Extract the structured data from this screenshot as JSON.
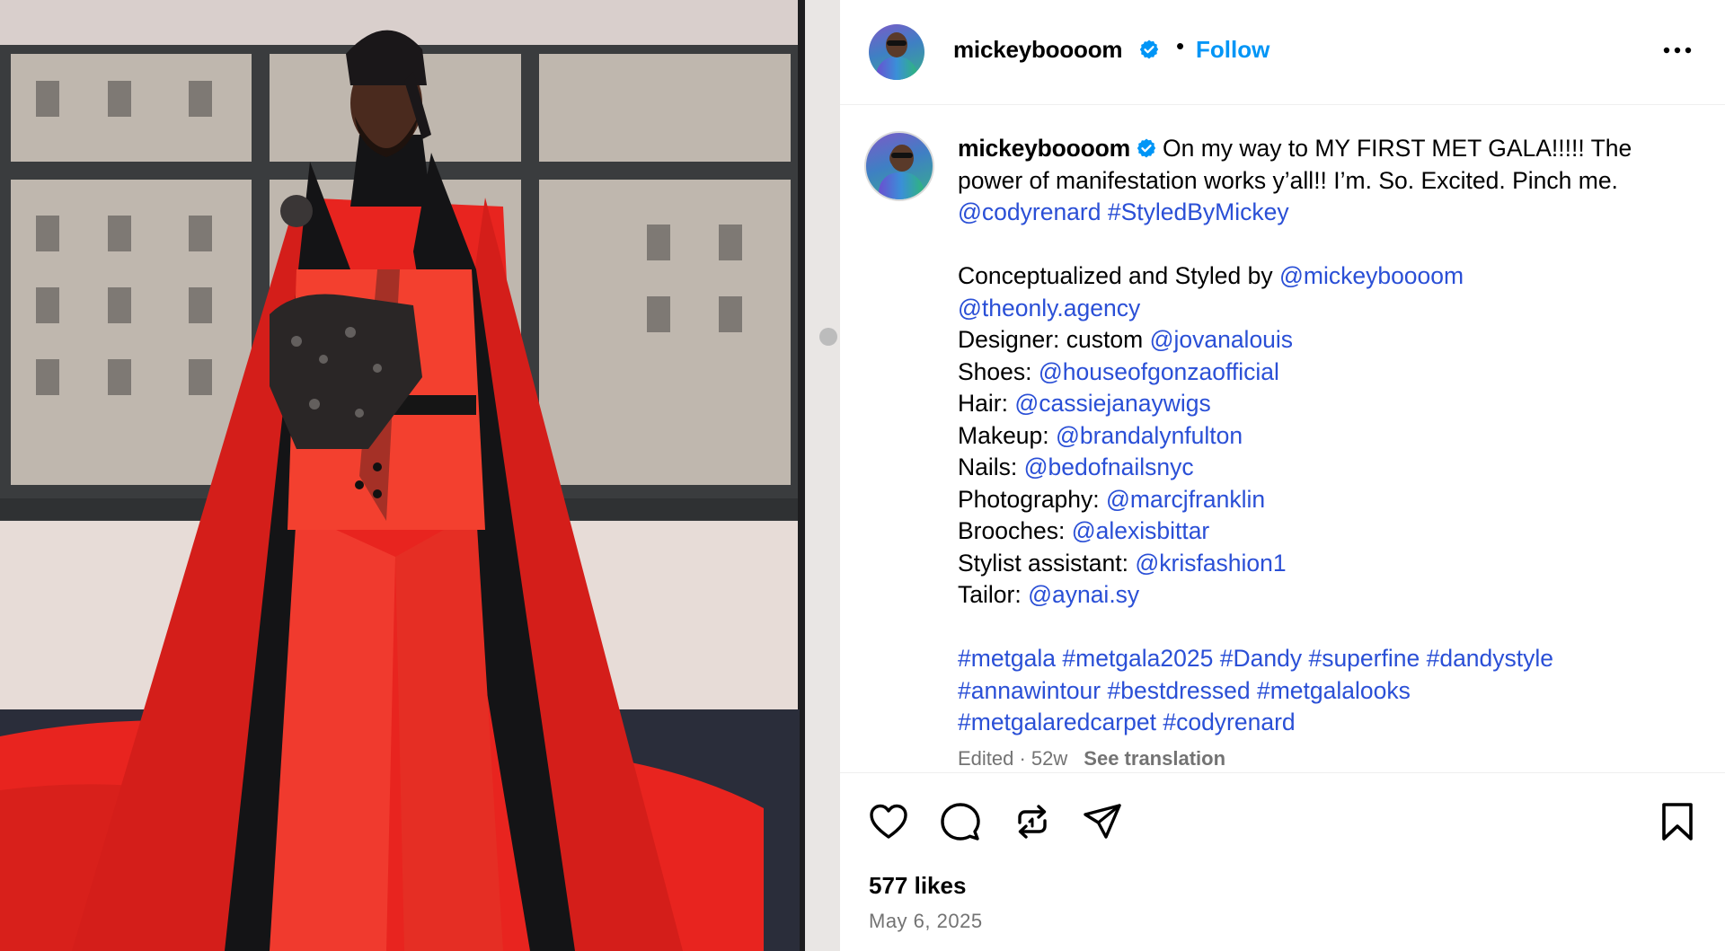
{
  "post": {
    "username": "mickeyboooom",
    "verified": true,
    "separator": "•",
    "follow_label": "Follow",
    "more_icon": "more-options-icon",
    "image_alt": "Photo of a man in a red satin suit with a long red and black cape, standing by a window"
  },
  "caption": {
    "username": "mickeyboooom",
    "intro": "On my way to MY FIRST MET GALA!!!!! The power of manifestation works y’all!! I’m. So. Excited. Pinch me.",
    "intro_tags": [
      "@codyrenard",
      "#StyledByMickey"
    ],
    "credits": [
      {
        "label": "Conceptualized and Styled by ",
        "handle": "@mickeyboooom"
      },
      {
        "label": "",
        "handle": "@theonly.agency"
      },
      {
        "label": "Designer: custom ",
        "handle": "@jovanalouis"
      },
      {
        "label": "Shoes: ",
        "handle": "@houseofgonzaofficial"
      },
      {
        "label": "Hair: ",
        "handle": "@cassiejanaywigs"
      },
      {
        "label": "Makeup: ",
        "handle": "@brandalynfulton"
      },
      {
        "label": "Nails: ",
        "handle": "@bedofnailsnyc"
      },
      {
        "label": "Photography: ",
        "handle": "@marcjfranklin"
      },
      {
        "label": "Brooches: ",
        "handle": "@alexisbittar"
      },
      {
        "label": "Stylist assistant: ",
        "handle": "@krisfashion1"
      },
      {
        "label": "Tailor: ",
        "handle": "@aynai.sy"
      }
    ],
    "hashtag_lines": [
      [
        "#metgala",
        "#metgala2025",
        "#Dandy",
        "#superfine",
        "#dandystyle"
      ],
      [
        "#annawintour",
        "#bestdressed",
        "#metgalalooks"
      ],
      [
        "#metgalaredcarpet",
        "#codyrenard"
      ]
    ],
    "edited": "Edited · 52w",
    "see_translation": "See translation"
  },
  "actions": {
    "like_icon": "heart-icon",
    "comment_icon": "comment-icon",
    "repost_icon": "repost-icon",
    "share_icon": "share-icon",
    "save_icon": "bookmark-icon"
  },
  "stats": {
    "likes": "577 likes",
    "date": "May 6, 2025"
  },
  "colors": {
    "link": "#2a4fd6",
    "follow": "#0095f6",
    "verified": "#0095f6",
    "cape_red": "#e8241f",
    "lapel_black": "#141416"
  }
}
